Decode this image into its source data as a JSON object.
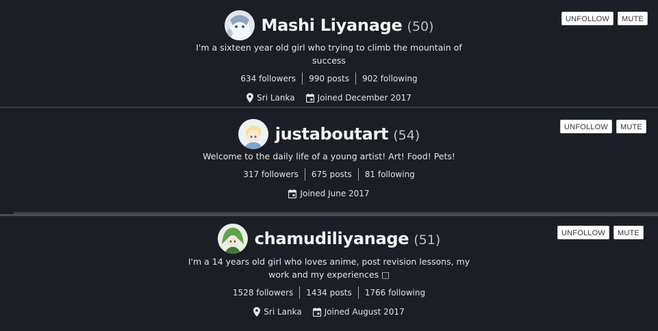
{
  "users": [
    {
      "username": "Mashi Liyanage",
      "reputation": "(50)",
      "about": "I'm a sixteen year old girl who trying to climb the mountain of success",
      "followers": "634 followers",
      "posts": "990 posts",
      "following": "902 following",
      "location": "Sri Lanka",
      "joined": "Joined December 2017",
      "unfollow_label": "UNFOLLOW",
      "mute_label": "MUTE"
    },
    {
      "username": "justaboutart",
      "reputation": "(54)",
      "about": "Welcome to the daily life of a young artist! Art! Food! Pets!",
      "followers": "317 followers",
      "posts": "675 posts",
      "following": "81 following",
      "joined": "Joined June 2017",
      "unfollow_label": "UNFOLLOW",
      "mute_label": "MUTE"
    },
    {
      "username": "chamudiliyanage",
      "reputation": "(51)",
      "about": "I'm a 14 years old girl who loves anime, post revision lessons, my work and my experiences □",
      "followers": "1528 followers",
      "posts": "1434 posts",
      "following": "1766 following",
      "location": "Sri Lanka",
      "joined": "Joined August 2017",
      "unfollow_label": "UNFOLLOW",
      "mute_label": "MUTE"
    }
  ],
  "icons": {
    "location": "map-pin-icon",
    "joined": "calendar-icon"
  },
  "colors": {
    "background": "#1b1e23",
    "text": "#e8e8e8",
    "button_bg": "#ffffff"
  }
}
